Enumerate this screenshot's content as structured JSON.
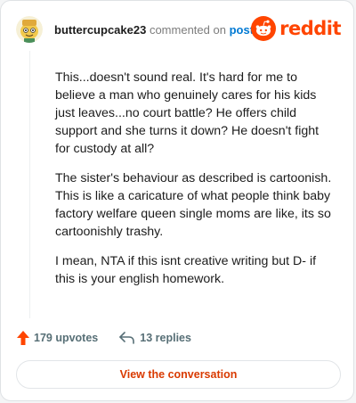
{
  "comment": {
    "username": "buttercupcake23",
    "action_text": "commented on",
    "post_link_text": "post",
    "paragraphs": [
      "This...doesn't sound real. It's hard for me to believe a man who genuinely cares for his kids just leaves...no court battle? He offers child support and she turns it down? He doesn't fight for custody at all?",
      "The sister's behaviour as described is cartoonish. This is like a caricature of what people think baby factory welfare queen single moms are like, its so cartoonishly trashy.",
      "I mean, NTA if this isnt creative writing but D- if this is your english homework."
    ]
  },
  "brand": {
    "wordmark": "reddit",
    "color": "#ff4500"
  },
  "footer": {
    "upvotes_label": "179 upvotes",
    "replies_label": "13 replies",
    "view_button_label": "View the conversation"
  },
  "icons": {
    "avatar": "snoo-avatar",
    "logo": "reddit-snoo-icon",
    "upvote": "upvote-arrow-icon",
    "reply": "reply-arrow-icon"
  }
}
